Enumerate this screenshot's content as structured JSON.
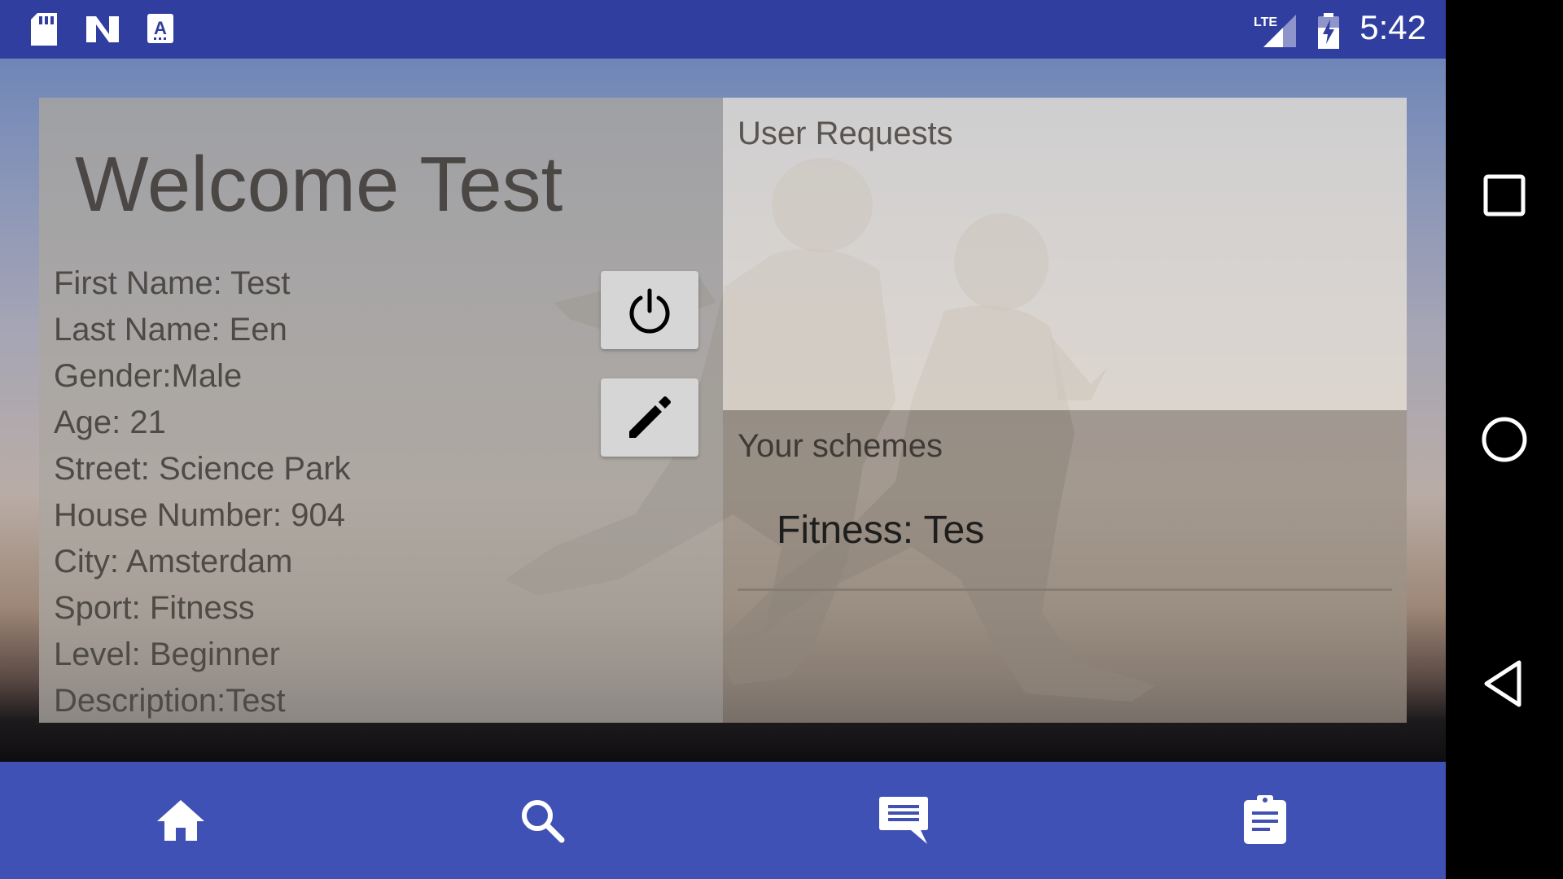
{
  "status_bar": {
    "time": "5:42",
    "network": "LTE",
    "icons": [
      "sd-card-icon",
      "n-logo-icon",
      "a-notification-icon",
      "lte-signal-icon",
      "battery-charging-icon"
    ]
  },
  "profile": {
    "welcome": "Welcome Test",
    "fields": [
      "First Name: Test",
      "Last Name: Een",
      "Gender:Male",
      "Age: 21",
      "Street: Science Park",
      "House Number: 904",
      "City: Amsterdam",
      "Sport: Fitness",
      "Level: Beginner",
      "Description:Test"
    ]
  },
  "actions": {
    "power_icon": "power-icon",
    "edit_icon": "pencil-icon"
  },
  "user_requests": {
    "title": "User Requests"
  },
  "schemes": {
    "title": "Your schemes",
    "items": [
      "Fitness: Tes"
    ]
  },
  "bottom_nav": {
    "items": [
      "home-icon",
      "search-icon",
      "message-icon",
      "clipboard-icon"
    ]
  },
  "system_nav": {
    "items": [
      "recents-icon",
      "home-circle-icon",
      "back-icon"
    ]
  },
  "colors": {
    "status_bar": "#303f9f",
    "bottom_nav": "#3f51b5",
    "system_nav": "#000000"
  }
}
